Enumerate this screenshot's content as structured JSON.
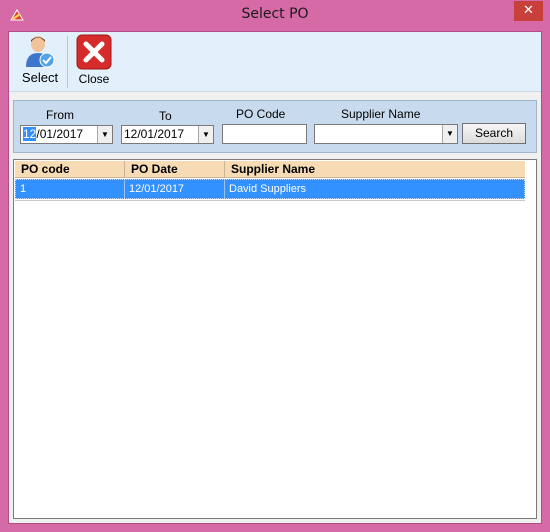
{
  "window": {
    "title": "Select PO",
    "close_glyph": "✕",
    "colors": {
      "frame": "#d66aa6",
      "close": "#c7403a",
      "toolbar": "#e2f0fb",
      "panel": "#c8dbee",
      "header": "#f6dbb4",
      "selection": "#3390ff"
    }
  },
  "toolbar": {
    "select_label": "Select",
    "close_label": "Close",
    "select_icon": "user-check-icon",
    "close_icon": "close-icon"
  },
  "filters": {
    "from_label": "From",
    "to_label": "To",
    "po_code_label": "PO Code",
    "supplier_label": "Supplier Name",
    "from_date_day": "12",
    "from_date_rest": "/01/2017",
    "to_date": "12/01/2017",
    "po_code_value": "",
    "supplier_value": "",
    "search_label": "Search"
  },
  "grid": {
    "columns": [
      "PO code",
      "PO Date",
      "Supplier Name"
    ],
    "rows": [
      {
        "po_code": "1",
        "po_date": "12/01/2017",
        "supplier": "David Suppliers"
      }
    ]
  }
}
